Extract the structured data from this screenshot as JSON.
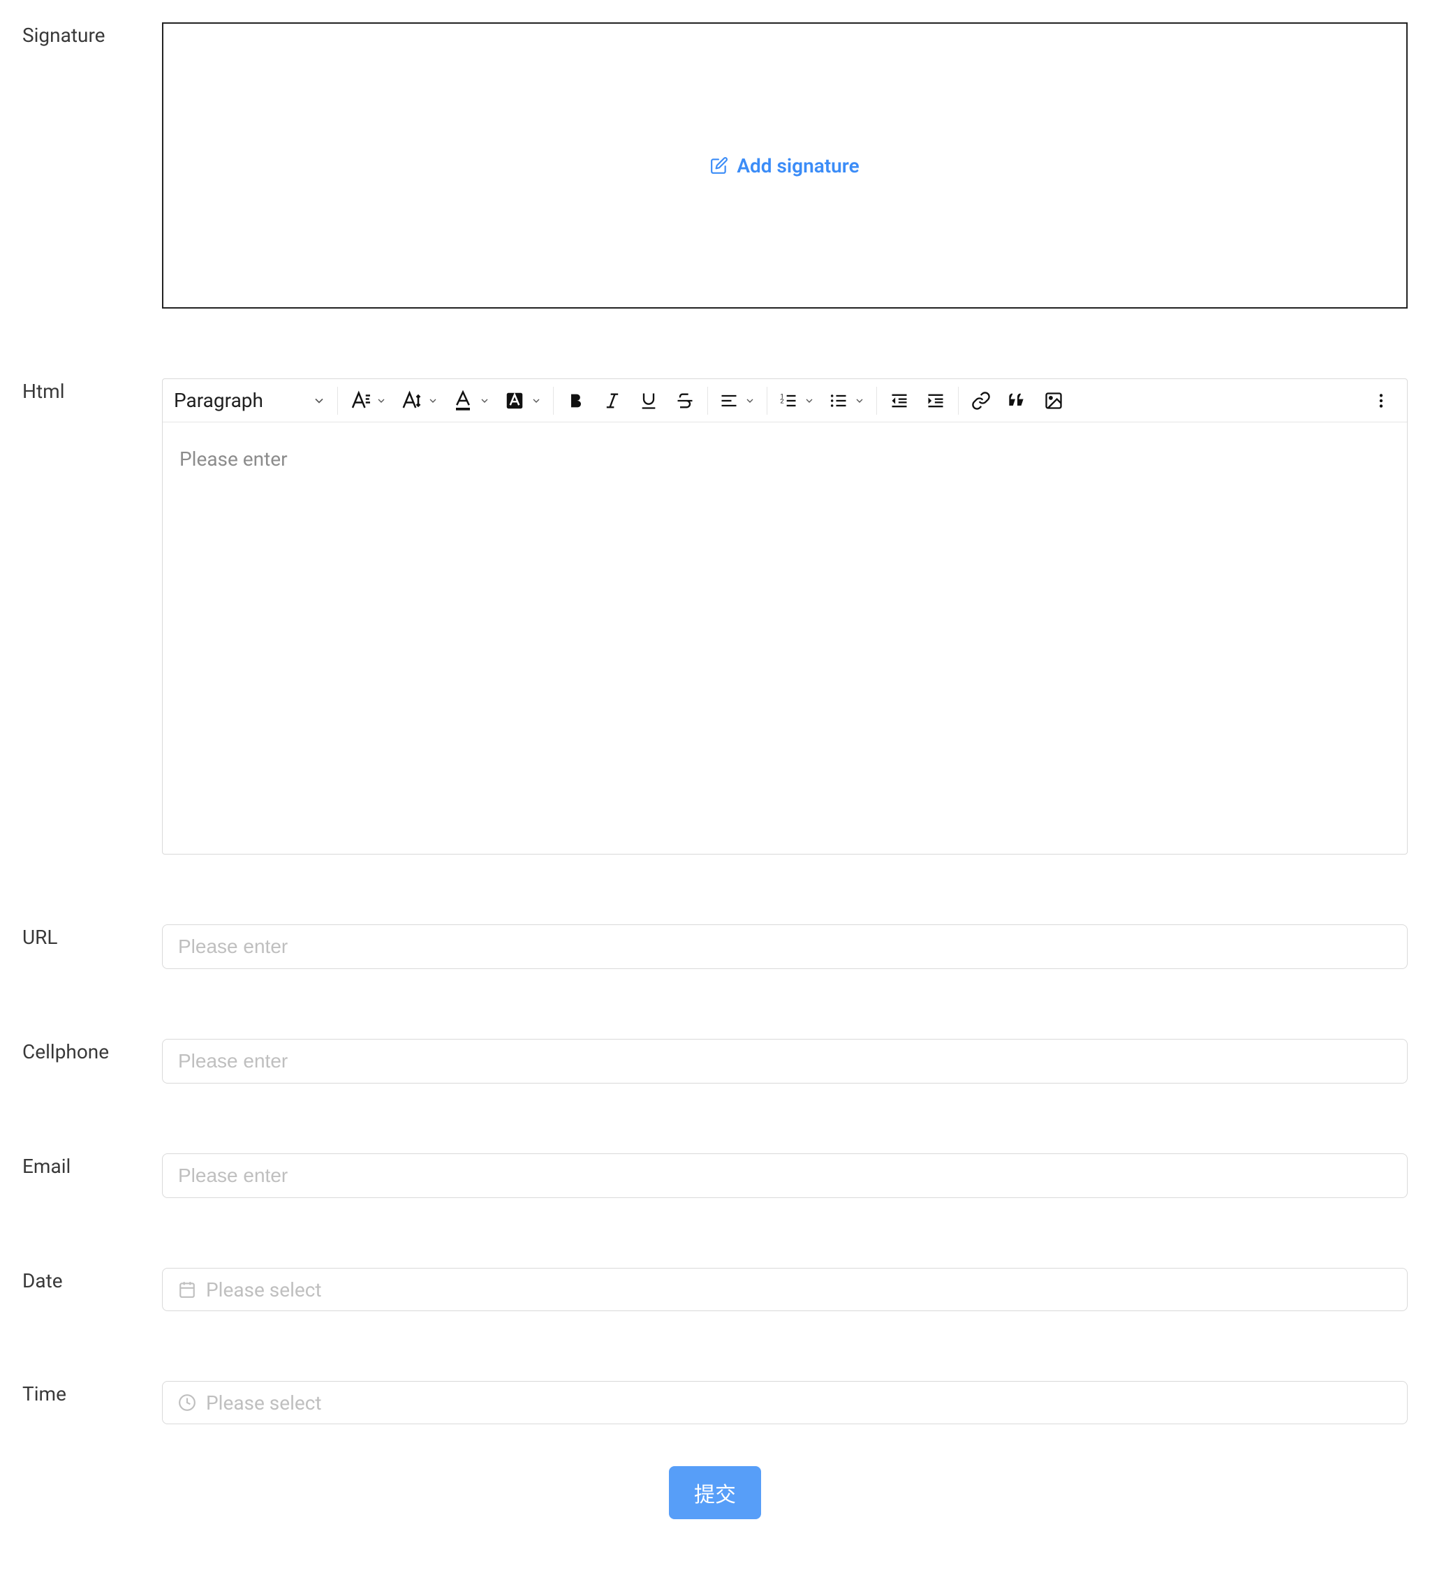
{
  "fields": {
    "signature": {
      "label": "Signature",
      "add_label": "Add signature"
    },
    "html": {
      "label": "Html",
      "heading_value": "Paragraph",
      "placeholder": "Please enter"
    },
    "url": {
      "label": "URL",
      "placeholder": "Please enter"
    },
    "cellphone": {
      "label": "Cellphone",
      "placeholder": "Please enter"
    },
    "email": {
      "label": "Email",
      "placeholder": "Please enter"
    },
    "date": {
      "label": "Date",
      "placeholder": "Please select"
    },
    "time": {
      "label": "Time",
      "placeholder": "Please select"
    }
  },
  "submit_label": "提交"
}
